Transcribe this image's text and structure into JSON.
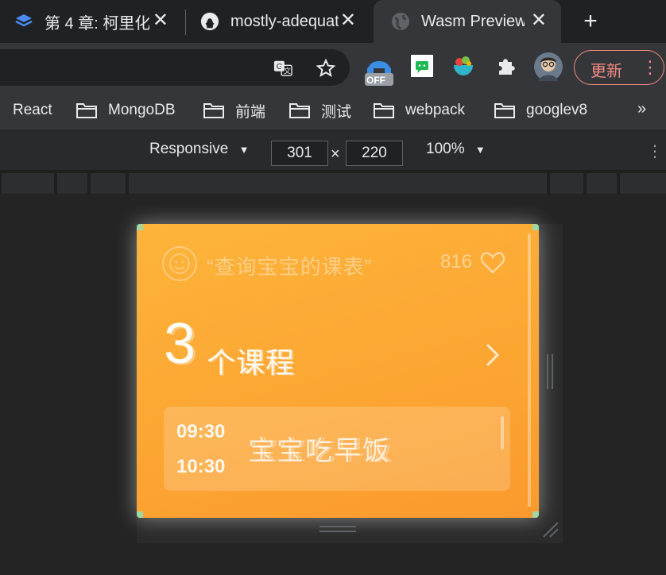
{
  "tabs": [
    {
      "title": "第 4 章: 柯里化",
      "favicon": "book-icon",
      "active": false
    },
    {
      "title": "mostly-adequate",
      "favicon": "github-icon",
      "active": false
    },
    {
      "title": "Wasm Preview",
      "favicon": "globe-icon",
      "active": true
    }
  ],
  "toolbar": {
    "update_label": "更新",
    "ext_off_badge": "OFF"
  },
  "bookmarks": [
    {
      "label": "React"
    },
    {
      "label": "MongoDB"
    },
    {
      "label": "前端"
    },
    {
      "label": "测试"
    },
    {
      "label": "webpack"
    },
    {
      "label": "googlev8"
    }
  ],
  "bookmarks_more": "»",
  "devtools": {
    "device": "Responsive",
    "width": "301",
    "height": "220",
    "separator": "×",
    "zoom": "100%"
  },
  "widget": {
    "title": "“查询宝宝的课表”",
    "likes": "816",
    "course_count": "3",
    "course_count_label": "个课程",
    "course": {
      "start": "09:30",
      "end": "10:30",
      "name": "宝宝吃早饭"
    }
  },
  "colors": {
    "widget_orange": "#fca532",
    "update_accent": "#f28b82"
  }
}
